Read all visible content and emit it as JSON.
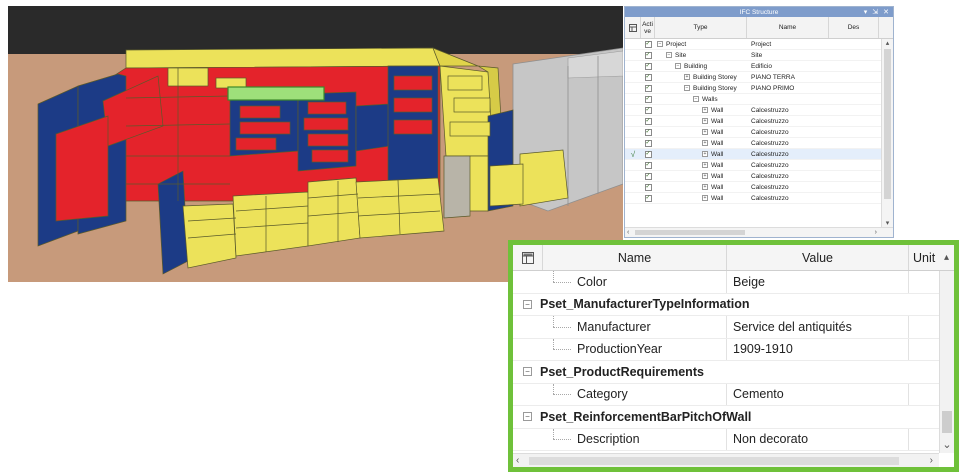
{
  "ifc_panel": {
    "title": "IFC Structure",
    "controls": [
      "▾",
      "⇲",
      "✕"
    ],
    "columns": {
      "active": "Acti ve",
      "type": "Type",
      "name": "Name",
      "description": "Des"
    },
    "rows": [
      {
        "indent": 0,
        "toggle": "−",
        "type": "Project",
        "name": "Project",
        "selected": false
      },
      {
        "indent": 1,
        "toggle": "−",
        "type": "Site",
        "name": "Site",
        "selected": false
      },
      {
        "indent": 2,
        "toggle": "−",
        "type": "Building",
        "name": "Edificio",
        "selected": false
      },
      {
        "indent": 3,
        "toggle": "+",
        "type": "Building Storey",
        "name": "PIANO TERRA",
        "selected": false
      },
      {
        "indent": 3,
        "toggle": "−",
        "type": "Building Storey",
        "name": "PIANO PRIMO",
        "selected": false
      },
      {
        "indent": 4,
        "toggle": "−",
        "type": "Walls",
        "name": "",
        "selected": false
      },
      {
        "indent": 5,
        "toggle": "+",
        "type": "Wall",
        "name": "Calcestruzzo",
        "selected": false
      },
      {
        "indent": 5,
        "toggle": "+",
        "type": "Wall",
        "name": "Calcestruzzo",
        "selected": false
      },
      {
        "indent": 5,
        "toggle": "+",
        "type": "Wall",
        "name": "Calcestruzzo",
        "selected": false
      },
      {
        "indent": 5,
        "toggle": "+",
        "type": "Wall",
        "name": "Calcestruzzo",
        "selected": false
      },
      {
        "indent": 5,
        "toggle": "+",
        "type": "Wall",
        "name": "Calcestruzzo",
        "selected": true
      },
      {
        "indent": 5,
        "toggle": "+",
        "type": "Wall",
        "name": "Calcestruzzo",
        "selected": false
      },
      {
        "indent": 5,
        "toggle": "+",
        "type": "Wall",
        "name": "Calcestruzzo",
        "selected": false
      },
      {
        "indent": 5,
        "toggle": "+",
        "type": "Wall",
        "name": "Calcestruzzo",
        "selected": false
      },
      {
        "indent": 5,
        "toggle": "+",
        "type": "Wall",
        "name": "Calcestruzzo",
        "selected": false
      }
    ]
  },
  "prop_panel": {
    "columns": {
      "name": "Name",
      "value": "Value",
      "unit": "Unit"
    },
    "rows": [
      {
        "kind": "leaf",
        "name": "Color",
        "value": "Beige"
      },
      {
        "kind": "group",
        "name": "Pset_ManufacturerTypeInformation"
      },
      {
        "kind": "leaf",
        "name": "Manufacturer",
        "value": "Service del antiquités"
      },
      {
        "kind": "leaf",
        "name": "ProductionYear",
        "value": "1909-1910"
      },
      {
        "kind": "group",
        "name": "Pset_ProductRequirements"
      },
      {
        "kind": "leaf",
        "name": "Category",
        "value": "Cemento"
      },
      {
        "kind": "group",
        "name": "Pset_ReinforcementBarPitchOfWall"
      },
      {
        "kind": "leaf",
        "name": "Description",
        "value": "Non decorato"
      }
    ]
  },
  "colors": {
    "sky": "#2a2a2a",
    "ground": "#c79a7b",
    "stone_red": "#e4232b",
    "stone_yellow": "#ece25a",
    "stone_blue": "#1c3b86",
    "wall_grey": "#bfbfbf",
    "selection": "#9ee07a",
    "panel_border": "#6fc13a",
    "titlebar": "#7e9ccb"
  }
}
